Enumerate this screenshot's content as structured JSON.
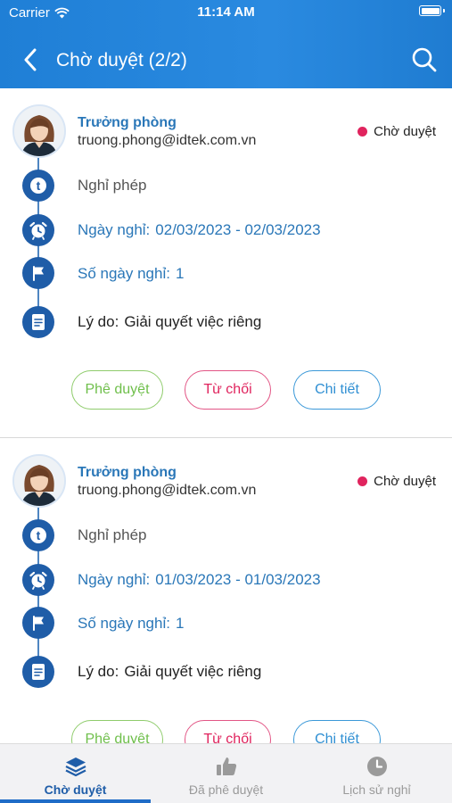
{
  "statusbar": {
    "carrier": "Carrier",
    "time": "11:14 AM"
  },
  "header": {
    "title": "Chờ duyệt (2/2)"
  },
  "requests": [
    {
      "name": "Trưởng phòng",
      "email": "truong.phong@idtek.com.vn",
      "status": "Chờ duyệt",
      "type": "Nghỉ phép",
      "date_label": "Ngày nghỉ:",
      "date_value": "02/03/2023 - 02/03/2023",
      "days_label": "Số ngày nghỉ:",
      "days_value": "1",
      "reason_label": "Lý do:",
      "reason_value": "Giải quyết việc riêng"
    },
    {
      "name": "Trưởng phòng",
      "email": "truong.phong@idtek.com.vn",
      "status": "Chờ duyệt",
      "type": "Nghỉ phép",
      "date_label": "Ngày nghỉ:",
      "date_value": "01/03/2023 - 01/03/2023",
      "days_label": "Số ngày nghỉ:",
      "days_value": "1",
      "reason_label": "Lý do:",
      "reason_value": "Giải quyết việc riêng"
    }
  ],
  "actions": {
    "approve": "Phê duyệt",
    "reject": "Từ chối",
    "detail": "Chi tiết"
  },
  "tabs": [
    {
      "label": "Chờ duyệt",
      "icon": "layers-icon",
      "active": true
    },
    {
      "label": "Đã phê duyệt",
      "icon": "thumbs-up-icon",
      "active": false
    },
    {
      "label": "Lịch sử nghỉ",
      "icon": "clock-icon",
      "active": false
    }
  ],
  "colors": {
    "header": "#1f7fd6",
    "accent": "#1f5da8",
    "approve": "#6fbf4b",
    "reject": "#e0245e",
    "detail": "#2f8fd3"
  }
}
